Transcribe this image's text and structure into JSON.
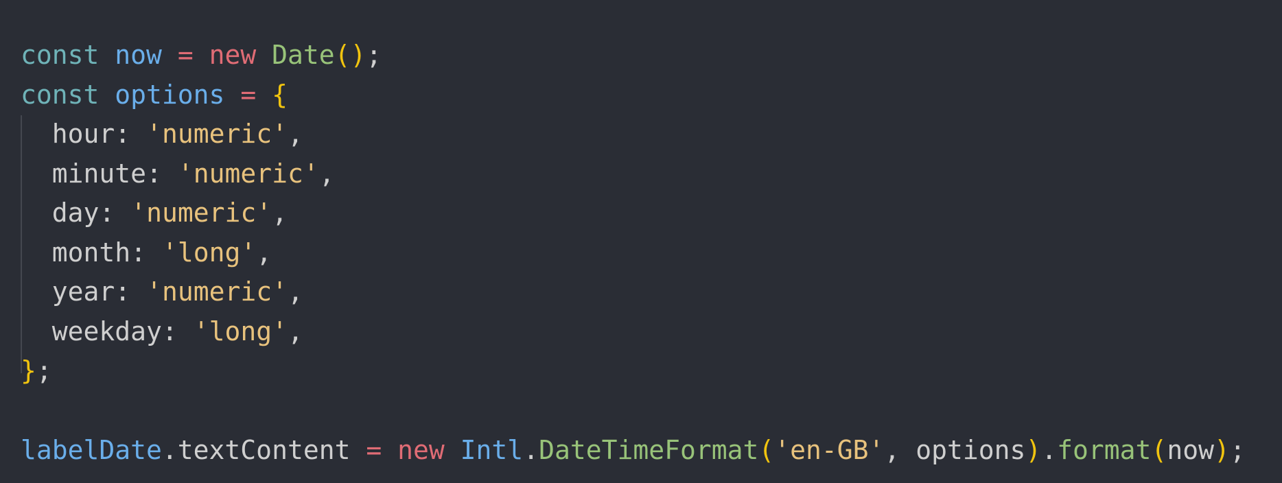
{
  "code": {
    "line1": {
      "kw": "const",
      "name": "now",
      "eq": "=",
      "new": "new",
      "cls": "Date",
      "open": "(",
      "close": ")",
      "semi": ";"
    },
    "line2": {
      "kw": "const",
      "name": "options",
      "eq": "=",
      "brace": "{"
    },
    "props": [
      {
        "key": "hour",
        "value": "'numeric'"
      },
      {
        "key": "minute",
        "value": "'numeric'"
      },
      {
        "key": "day",
        "value": "'numeric'"
      },
      {
        "key": "month",
        "value": "'long'"
      },
      {
        "key": "year",
        "value": "'numeric'"
      },
      {
        "key": "weekday",
        "value": "'long'"
      }
    ],
    "colon": ":",
    "comma": ",",
    "closing": {
      "brace": "}",
      "semi": ";"
    },
    "last": {
      "obj": "labelDate",
      "dot1": ".",
      "prop": "textContent",
      "eq": "=",
      "new": "new",
      "ns": "Intl",
      "dot2": ".",
      "ctor": "DateTimeFormat",
      "open1": "(",
      "locale": "'en-GB'",
      "comma": ",",
      "arg": "options",
      "close1": ")",
      "dot3": ".",
      "method": "format",
      "open2": "(",
      "arg2": "now",
      "close2": ")",
      "semi": ";"
    }
  }
}
